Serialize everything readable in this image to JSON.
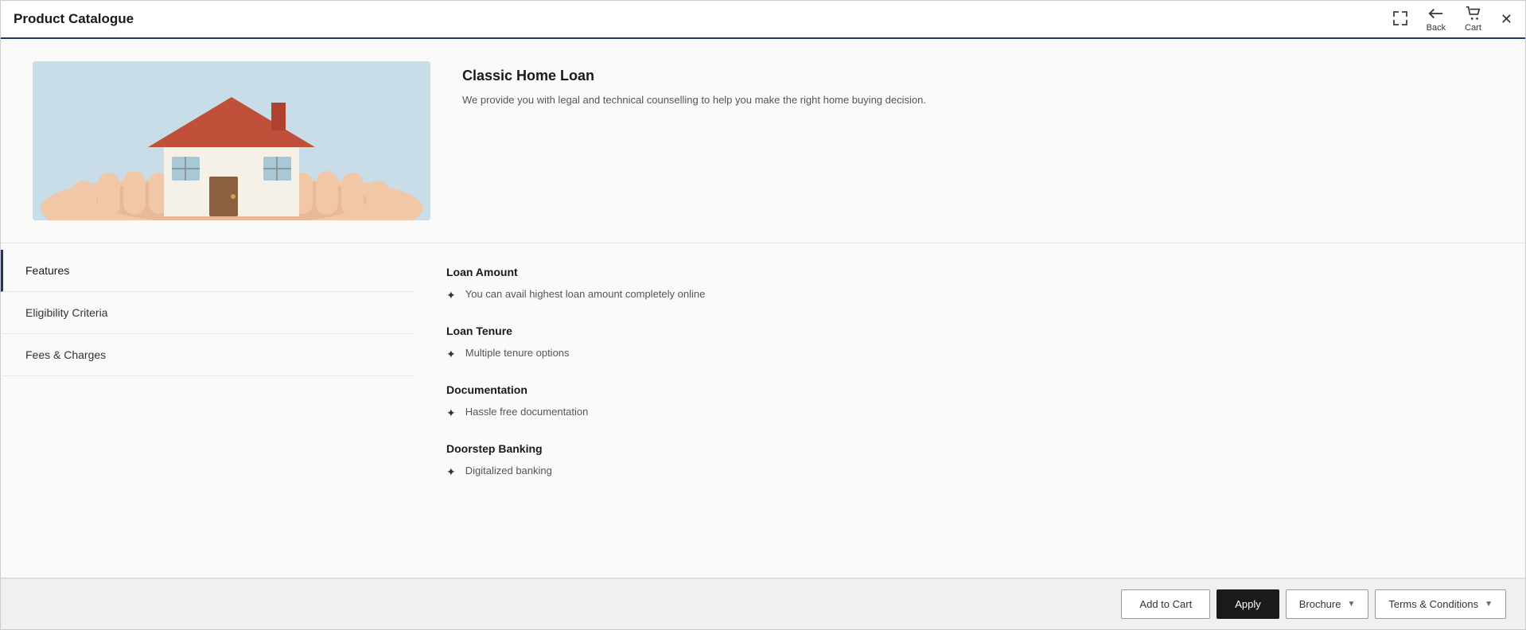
{
  "window": {
    "title": "Product Catalogue"
  },
  "header": {
    "back_label": "Back",
    "cart_label": "Cart"
  },
  "product": {
    "title": "Classic Home Loan",
    "description": "We provide you with legal and technical counselling to help you make the right home buying decision."
  },
  "sidebar": {
    "items": [
      {
        "id": "features",
        "label": "Features",
        "active": true
      },
      {
        "id": "eligibility",
        "label": "Eligibility Criteria",
        "active": false
      },
      {
        "id": "fees",
        "label": "Fees & Charges",
        "active": false
      }
    ]
  },
  "features": {
    "sections": [
      {
        "title": "Loan Amount",
        "items": [
          "You can avail highest loan amount completely online"
        ]
      },
      {
        "title": "Loan Tenure",
        "items": [
          "Multiple tenure options"
        ]
      },
      {
        "title": "Documentation",
        "items": [
          "Hassle free documentation"
        ]
      },
      {
        "title": "Doorstep Banking",
        "items": [
          "Digitalized banking"
        ]
      }
    ]
  },
  "footer": {
    "add_to_cart_label": "Add to Cart",
    "apply_label": "Apply",
    "brochure_label": "Brochure",
    "terms_label": "Terms & Conditions"
  }
}
